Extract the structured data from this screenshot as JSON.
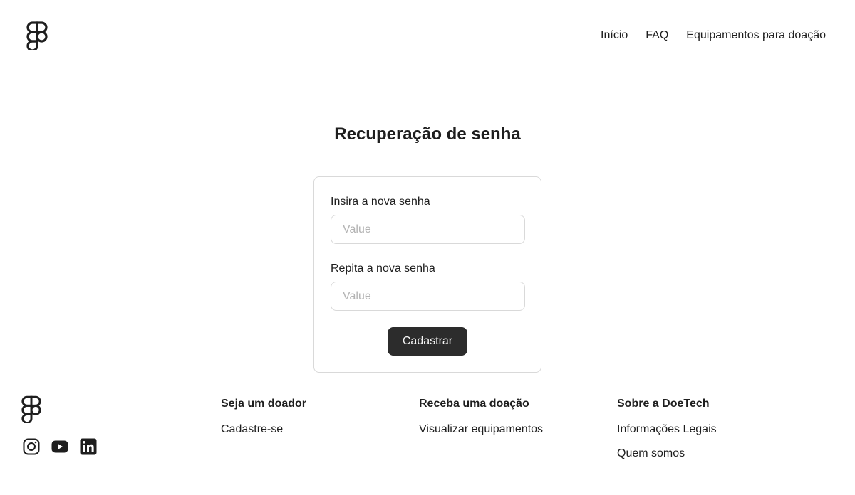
{
  "header": {
    "logo_icon": "figma-logo-icon",
    "nav": [
      {
        "label": "Início"
      },
      {
        "label": "FAQ"
      },
      {
        "label": "Equipamentos para doação"
      }
    ]
  },
  "main": {
    "title": "Recuperação de senha",
    "form": {
      "new_password_label": "Insira a nova senha",
      "new_password_placeholder": "Value",
      "repeat_password_label": "Repita a nova senha",
      "repeat_password_placeholder": "Value",
      "submit_label": "Cadastrar"
    }
  },
  "footer": {
    "logo_icon": "figma-logo-icon",
    "social_icons": [
      "instagram-icon",
      "youtube-icon",
      "linkedin-icon"
    ],
    "columns": [
      {
        "title": "Seja um doador",
        "links": [
          "Cadastre-se"
        ]
      },
      {
        "title": "Receba uma doação",
        "links": [
          "Visualizar equipamentos"
        ]
      },
      {
        "title": "Sobre a DoeTech",
        "links": [
          "Informações Legais",
          "Quem somos"
        ]
      }
    ]
  },
  "colors": {
    "text": "#1e1e1e",
    "border": "#d9d9d9",
    "button": "#2c2c2c",
    "button_text": "#f5f5f5",
    "placeholder": "#b3b3b3"
  }
}
